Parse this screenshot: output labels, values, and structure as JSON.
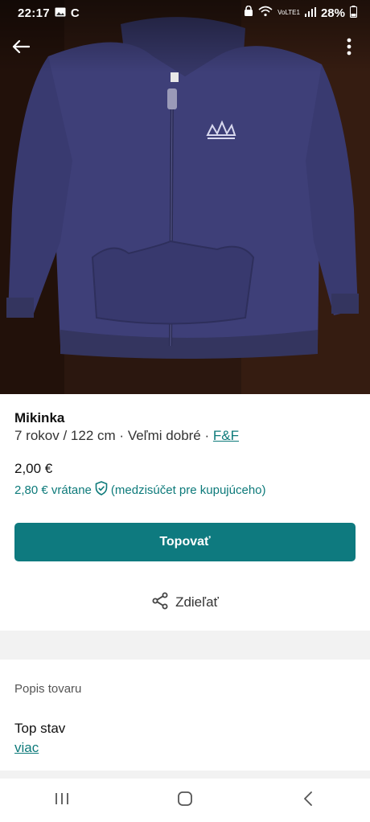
{
  "status_bar": {
    "time": "22:17",
    "icons_left": [
      "image-icon",
      "c-app-icon"
    ],
    "icons_right": [
      "lock-icon",
      "wifi-icon",
      "volte-icon",
      "signal-icon"
    ],
    "volte_label": "VoLTE1",
    "battery": "28%"
  },
  "photo": {
    "description_icon": "hoodie-photo",
    "background_color": "#2a160f",
    "hoodie_color": "#3e3f78"
  },
  "toolbar": {
    "back_icon": "arrow-left-icon",
    "more_icon": "more-vertical-icon"
  },
  "item": {
    "title": "Mikinka",
    "size": "7 rokov / 122 cm",
    "condition": "Veľmi dobré",
    "separator": "·",
    "brand": "F&F",
    "price": "2,00 €",
    "price_incl_amount": "2,80 € vrátane",
    "price_incl_note": "(medzisúčet pre kupujúceho)",
    "shield_icon": "shield-check-icon"
  },
  "actions": {
    "bump_label": "Topovať",
    "share_label": "Zdieľať",
    "share_icon": "share-icon"
  },
  "description": {
    "header": "Popis tovaru",
    "text": "Top stav",
    "more_label": "viac"
  },
  "nav_bar": {
    "recent_icon": "recent-apps-icon",
    "home_icon": "home-icon",
    "back_icon": "back-chevron-icon"
  },
  "colors": {
    "accent": "#0e7a7f",
    "link": "#0d7a7a",
    "band": "#f2f2f2"
  }
}
